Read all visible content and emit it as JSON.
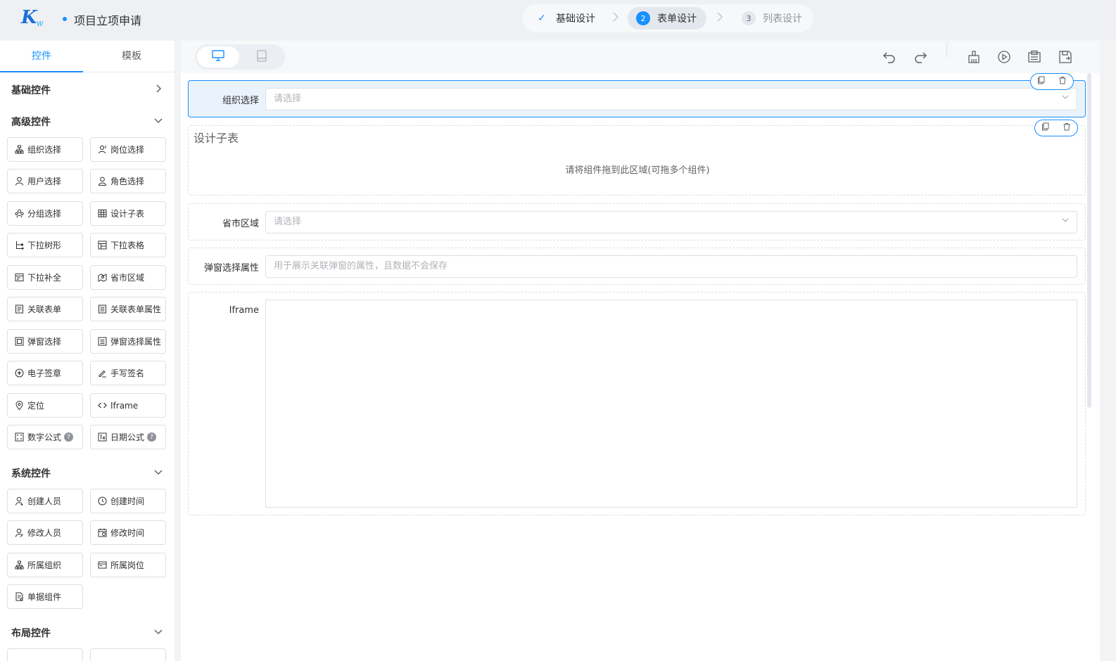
{
  "header": {
    "logo_text": "K",
    "logo_sub": "w",
    "title": "项目立项申请",
    "steps": [
      {
        "num": "✓",
        "label": "基础设计",
        "state": "done"
      },
      {
        "num": "2",
        "label": "表单设计",
        "state": "active"
      },
      {
        "num": "3",
        "label": "列表设计",
        "state": "pending"
      }
    ]
  },
  "sidebar": {
    "tabs": [
      "控件",
      "模板"
    ],
    "groups": {
      "basic": {
        "title": "基础控件",
        "collapsed": true
      },
      "advanced": {
        "title": "高级控件",
        "items": [
          {
            "label": "组织选择",
            "icon": "org-icon"
          },
          {
            "label": "岗位选择",
            "icon": "post-icon"
          },
          {
            "label": "用户选择",
            "icon": "user-icon"
          },
          {
            "label": "角色选择",
            "icon": "role-icon"
          },
          {
            "label": "分组选择",
            "icon": "group-icon"
          },
          {
            "label": "设计子表",
            "icon": "table-icon"
          },
          {
            "label": "下拉树形",
            "icon": "tree-icon"
          },
          {
            "label": "下拉表格",
            "icon": "dropdown-table-icon"
          },
          {
            "label": "下拉补全",
            "icon": "autocomplete-icon"
          },
          {
            "label": "省市区域",
            "icon": "region-icon"
          },
          {
            "label": "关联表单",
            "icon": "relation-form-icon"
          },
          {
            "label": "关联表单属性",
            "icon": "relation-attr-icon"
          },
          {
            "label": "弹窗选择",
            "icon": "popup-select-icon"
          },
          {
            "label": "弹窗选择属性",
            "icon": "popup-attr-icon"
          },
          {
            "label": "电子签章",
            "icon": "seal-icon"
          },
          {
            "label": "手写签名",
            "icon": "signature-icon"
          },
          {
            "label": "定位",
            "icon": "location-icon"
          },
          {
            "label": "Iframe",
            "icon": "code-icon"
          },
          {
            "label": "数字公式",
            "icon": "number-formula-icon",
            "help": "?"
          },
          {
            "label": "日期公式",
            "icon": "date-formula-icon",
            "help": "?"
          }
        ]
      },
      "system": {
        "title": "系统控件",
        "items": [
          {
            "label": "创建人员",
            "icon": "creator-icon"
          },
          {
            "label": "创建时间",
            "icon": "clock-icon"
          },
          {
            "label": "修改人员",
            "icon": "modifier-icon"
          },
          {
            "label": "修改时间",
            "icon": "calendar-icon"
          },
          {
            "label": "所属组织",
            "icon": "org-icon"
          },
          {
            "label": "所属岗位",
            "icon": "post-card-icon"
          },
          {
            "label": "单据组件",
            "icon": "document-icon"
          }
        ]
      },
      "layout": {
        "title": "布局控件"
      }
    }
  },
  "canvas": {
    "fields": {
      "org": {
        "label": "组织选择",
        "placeholder": "请选择"
      },
      "subtable": {
        "title": "设计子表",
        "hint": "请将组件拖到此区域(可拖多个组件)"
      },
      "region": {
        "label": "省市区域",
        "placeholder": "请选择"
      },
      "popup_attr": {
        "label": "弹窗选择属性",
        "placeholder": "用于展示关联弹窗的属性，且数据不会保存"
      },
      "iframe": {
        "label": "Iframe"
      }
    }
  },
  "colors": {
    "accent": "#1890ff",
    "active_bg": "#eaf3fc",
    "header_bg": "#eef0f4"
  }
}
